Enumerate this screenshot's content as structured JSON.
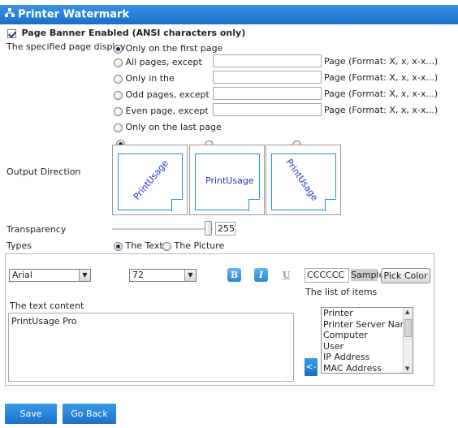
{
  "header": {
    "title": "Printer Watermark",
    "icon": "network-icon"
  },
  "banner": {
    "label": "Page Banner Enabled (ANSI characters only)",
    "checked": true
  },
  "page_display": {
    "label": "The specified page display",
    "options": [
      {
        "label": "Only on the first page",
        "selected": true,
        "has_input": false,
        "value": "",
        "hint": ""
      },
      {
        "label": "All pages, except",
        "selected": false,
        "has_input": true,
        "value": "",
        "hint": "Page (Format: X, x, x-x...)"
      },
      {
        "label": "Only in the",
        "selected": false,
        "has_input": true,
        "value": "",
        "hint": "Page (Format: X, x, x-x...)"
      },
      {
        "label": "Odd pages, except",
        "selected": false,
        "has_input": true,
        "value": "",
        "hint": "Page (Format: X, x, x-x...)"
      },
      {
        "label": "Even page, except",
        "selected": false,
        "has_input": true,
        "value": "",
        "hint": "Page (Format: X, x, x-x...)"
      },
      {
        "label": "Only on the last page",
        "selected": false,
        "has_input": false,
        "value": "",
        "hint": ""
      }
    ]
  },
  "output_direction": {
    "label": "Output Direction",
    "sample_text": "PrintUsage",
    "choices": [
      {
        "orientation": "ascending-diagonal",
        "selected": true
      },
      {
        "orientation": "horizontal",
        "selected": false
      },
      {
        "orientation": "descending-diagonal",
        "selected": false
      }
    ]
  },
  "transparency": {
    "label": "Transparency",
    "value": "255",
    "slider_fraction": 1.0
  },
  "types": {
    "label": "Types",
    "options": [
      {
        "label": "The Text",
        "selected": true
      },
      {
        "label": "The Picture",
        "selected": false
      }
    ]
  },
  "text_settings": {
    "font": "Arial",
    "size": "72",
    "bold_label": "B",
    "italic_label": "I",
    "underline_label": "U",
    "color_value": "CCCCCC",
    "sample_label": "Sample",
    "pick_color_label": "Pick Color",
    "list_label": "The list of items",
    "list_items": [
      "Printer",
      "Printer Server Name",
      "Computer",
      "User",
      "IP Address",
      "MAC Address"
    ],
    "insert_button": "<-",
    "content_label": "The text content",
    "content_value": "PrintUsage Pro"
  },
  "footer": {
    "save_label": "Save",
    "back_label": "Go Back"
  },
  "colors": {
    "title_bar": "#1b6fc8",
    "button_blue": "#1b70c8",
    "sheet_border": "#1e8fd6",
    "watermark_text": "#2233cc"
  }
}
